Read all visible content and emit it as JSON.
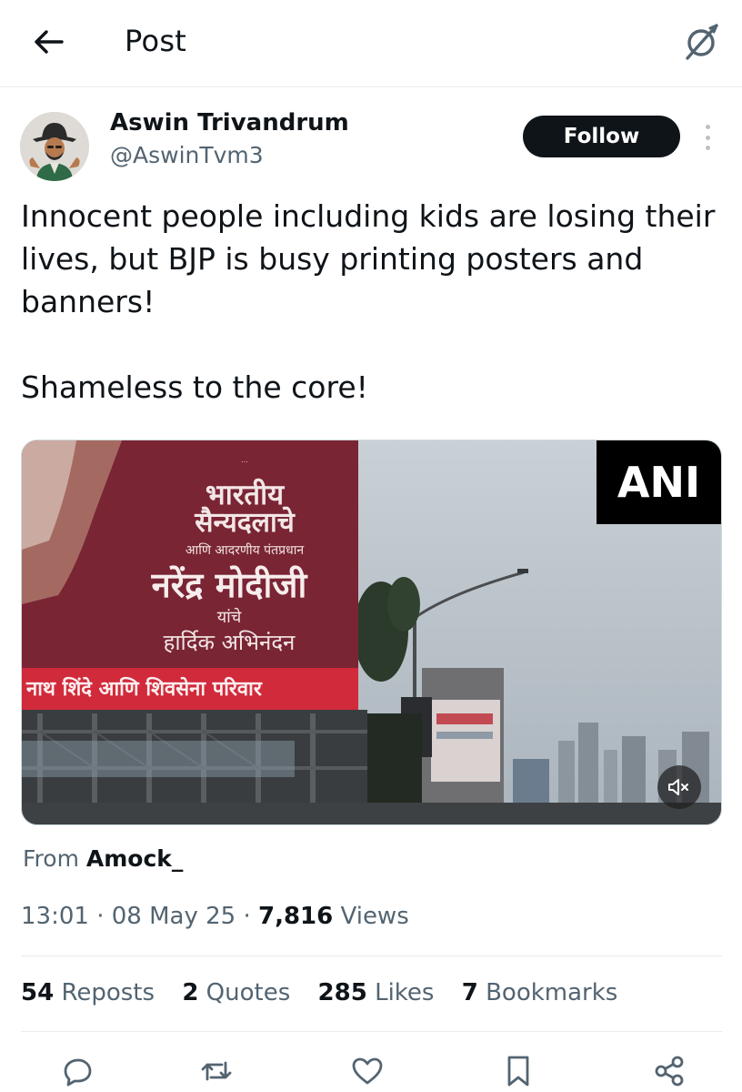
{
  "header": {
    "title": "Post",
    "back_icon": "arrow-left-icon",
    "grok_icon": "grok-slash-circle-icon"
  },
  "tweet": {
    "author": {
      "display_name": "Aswin Trivandrum",
      "handle": "@AswinTvm3",
      "follow_label": "Follow"
    },
    "text": {
      "line1": "Innocent people including kids are losing their lives, but BJP is busy printing posters and banners!",
      "line2": "Shameless to the core!"
    },
    "media": {
      "type": "video",
      "watermark": "ANI",
      "billboard": {
        "small_top": "…",
        "line1": "भारतीय",
        "line2": "सैन्यदलाचे",
        "line3": "आणि आदरणीय पंतप्रधान",
        "line4": "नरेंद्र मोदीजी",
        "line5": "यांचे",
        "line6": "हार्दिक अभिनंदन",
        "banner": "नाथ शिंदे आणि शिवसेना परिवार"
      },
      "muted": true
    },
    "source": {
      "prefix": "From",
      "name": "Amock_"
    },
    "meta": {
      "time": "13:01",
      "date": "08 May 25",
      "views_count": "7,816",
      "views_label": "Views",
      "separator": "·"
    },
    "stats": {
      "reposts_count": "54",
      "reposts_label": "Reposts",
      "quotes_count": "2",
      "quotes_label": "Quotes",
      "likes_count": "285",
      "likes_label": "Likes",
      "bookmarks_count": "7",
      "bookmarks_label": "Bookmarks"
    },
    "actions": [
      "reply-icon",
      "repost-icon",
      "like-icon",
      "bookmark-icon",
      "share-icon"
    ]
  },
  "colors": {
    "text_primary": "#0f1419",
    "text_secondary": "#536471",
    "divider": "#e7ecf0",
    "billboard_maroon": "#7a2534",
    "banner_red": "#d12a3b"
  }
}
